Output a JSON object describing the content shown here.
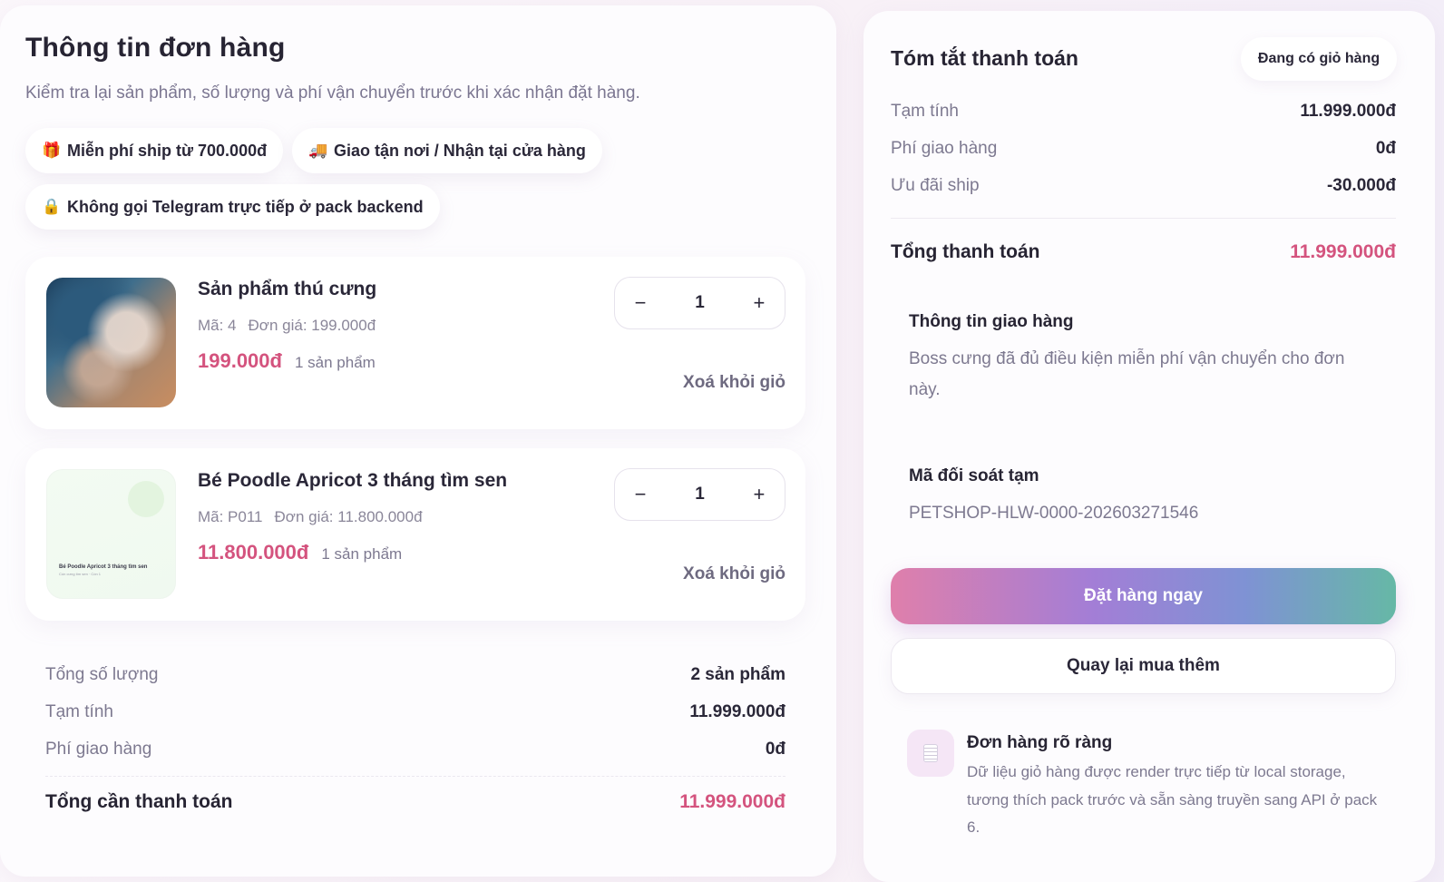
{
  "order": {
    "title": "Thông tin đơn hàng",
    "subtitle": "Kiểm tra lại sản phẩm, số lượng và phí vận chuyển trước khi xác nhận đặt hàng.",
    "chips": [
      {
        "icon": "gift-icon",
        "glyph": "🎁",
        "label": "Miễn phí ship từ 700.000đ"
      },
      {
        "icon": "truck-icon",
        "glyph": "🚚",
        "label": "Giao tận nơi / Nhận tại cửa hàng"
      },
      {
        "icon": "lock-icon",
        "glyph": "🔒",
        "label": "Không gọi Telegram trực tiếp ở pack backend"
      }
    ],
    "items": [
      {
        "name": "Sản phẩm thú cưng",
        "code": "Mã: 4",
        "unit_price": "Đơn giá: 199.000đ",
        "price": "199.000đ",
        "count": "1 sản phẩm",
        "qty": "1",
        "remove": "Xoá khỏi giỏ"
      },
      {
        "name": "Bé Poodle Apricot 3 tháng tìm sen",
        "code": "Mã: P011",
        "unit_price": "Đơn giá: 11.800.000đ",
        "price": "11.800.000đ",
        "count": "1 sản phẩm",
        "qty": "1",
        "remove": "Xoá khỏi giỏ",
        "thumb_title": "Bé Poodle Apricot 3 tháng tìm sen",
        "thumb_sub": "Cún cưng tìm sen · Còn 1"
      }
    ],
    "qty_minus": "−",
    "qty_plus": "+",
    "summary": {
      "total_qty_label": "Tổng số lượng",
      "total_qty_value": "2 sản phẩm",
      "subtotal_label": "Tạm tính",
      "subtotal_value": "11.999.000đ",
      "shipping_label": "Phí giao hàng",
      "shipping_value": "0đ",
      "total_label": "Tổng cần thanh toán",
      "total_value": "11.999.000đ"
    }
  },
  "payment": {
    "title": "Tóm tắt thanh toán",
    "status": "Đang có giỏ hàng",
    "subtotal_label": "Tạm tính",
    "subtotal_value": "11.999.000đ",
    "shipping_label": "Phí giao hàng",
    "shipping_value": "0đ",
    "discount_label": "Ưu đãi ship",
    "discount_value": "-30.000đ",
    "total_label": "Tổng thanh toán",
    "total_value": "11.999.000đ",
    "delivery_title": "Thông tin giao hàng",
    "delivery_text": "Boss cưng đã đủ điều kiện miễn phí vận chuyển cho đơn này.",
    "ref_title": "Mã đối soát tạm",
    "ref_value": "PETSHOP-HLW-0000-202603271546",
    "order_button": "Đặt hàng ngay",
    "back_button": "Quay lại mua thêm",
    "note_title": "Đơn hàng rõ ràng",
    "note_text": "Dữ liệu giỏ hàng được render trực tiếp từ local storage, tương thích pack trước và sẵn sàng truyền sang API ở pack 6."
  },
  "colors": {
    "accent_price": "#d4537e",
    "text_dark": "#272433",
    "text_muted": "#7d7990"
  }
}
